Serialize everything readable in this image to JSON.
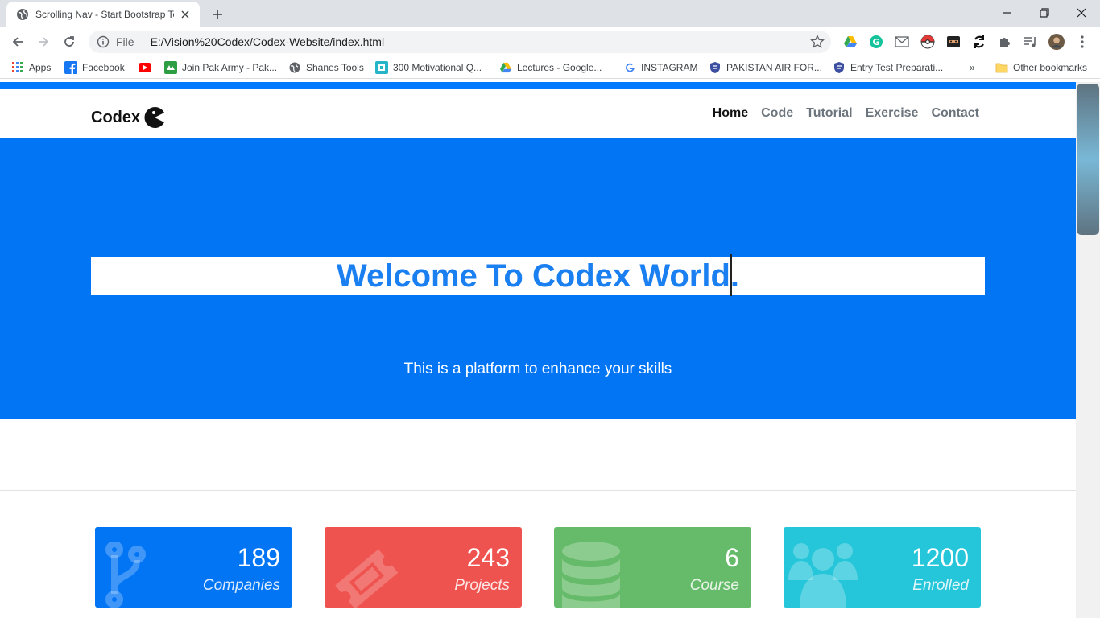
{
  "browser": {
    "tab_title": "Scrolling Nav - Start Bootstrap Te",
    "url_scheme": "File",
    "url": "E:/Vision%20Codex/Codex-Website/index.html",
    "bookmarks": [
      {
        "label": "Apps",
        "icon": "apps-grid-icon"
      },
      {
        "label": "Facebook",
        "icon": "facebook-icon"
      },
      {
        "label": "",
        "icon": "youtube-icon"
      },
      {
        "label": "Join Pak Army - Pak...",
        "icon": "army-icon"
      },
      {
        "label": "Shanes Tools",
        "icon": "globe-icon"
      },
      {
        "label": "300 Motivational Q...",
        "icon": "quote-icon"
      },
      {
        "label": "Lectures - Google...",
        "icon": "drive-icon"
      },
      {
        "label": "INSTAGRAM",
        "icon": "google-icon"
      },
      {
        "label": "PAKISTAN AIR FOR...",
        "icon": "paf-icon"
      },
      {
        "label": "Entry Test Preparati...",
        "icon": "paf-icon"
      }
    ],
    "more_bookmarks": "»",
    "other_bookmarks": "Other bookmarks"
  },
  "site": {
    "brand": "Codex",
    "nav": [
      "Home",
      "Code",
      "Tutorial",
      "Exercise",
      "Contact"
    ],
    "hero_title": "Welcome To Codex World.",
    "hero_subtitle": "This is a platform to enhance your skills"
  },
  "stats": [
    {
      "value": "189",
      "label": "Companies",
      "color": "#0275f5",
      "icon": "code-fork-icon"
    },
    {
      "value": "243",
      "label": "Projects",
      "color": "#ef5350",
      "icon": "ticket-icon"
    },
    {
      "value": "6",
      "label": "Course",
      "color": "#66bb6a",
      "icon": "database-icon"
    },
    {
      "value": "1200",
      "label": "Enrolled",
      "color": "#26c6da",
      "icon": "users-icon"
    }
  ],
  "colors": {
    "primary": "#007bff",
    "hero_title": "#1a7ff0"
  }
}
